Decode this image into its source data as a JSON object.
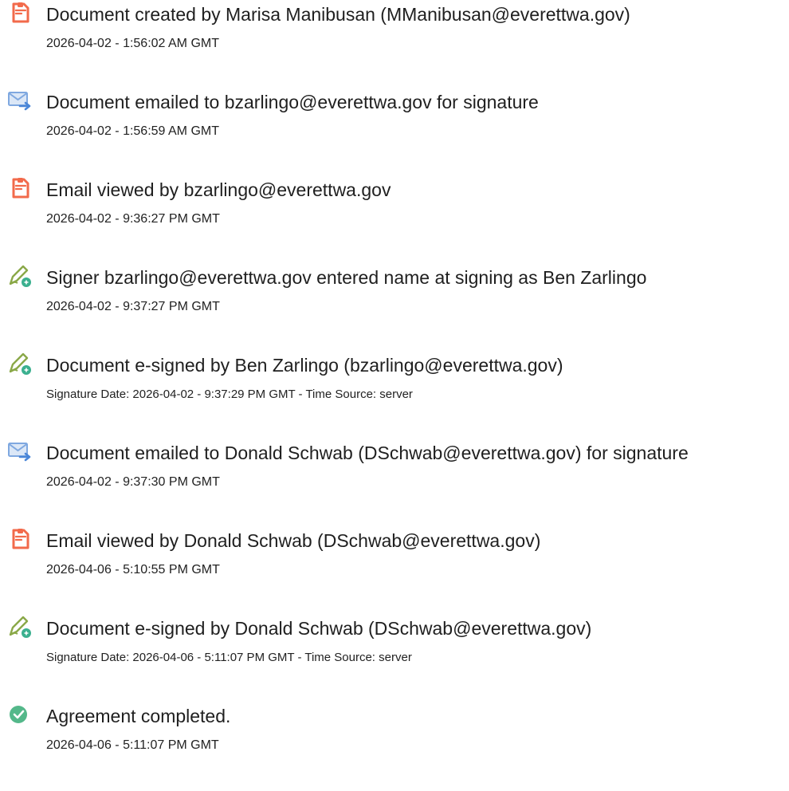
{
  "events": [
    {
      "icon": "document-icon",
      "title": "Document created by Marisa Manibusan (MManibusan@everettwa.gov)",
      "detail": "2026-04-02 - 1:56:02 AM GMT"
    },
    {
      "icon": "email-send-icon",
      "title": "Document emailed to bzarlingo@everettwa.gov for signature",
      "detail": "2026-04-02 - 1:56:59 AM GMT"
    },
    {
      "icon": "document-icon",
      "title": "Email viewed by bzarlingo@everettwa.gov",
      "detail": "2026-04-02 - 9:36:27 PM GMT"
    },
    {
      "icon": "pen-sign-icon",
      "title": "Signer bzarlingo@everettwa.gov entered name at signing as Ben Zarlingo",
      "detail": "2026-04-02 - 9:37:27 PM GMT"
    },
    {
      "icon": "pen-sign-icon",
      "title": "Document e-signed by Ben Zarlingo (bzarlingo@everettwa.gov)",
      "detail": "Signature Date: 2026-04-02 - 9:37:29 PM GMT - Time Source: server"
    },
    {
      "icon": "email-send-icon",
      "title": "Document emailed to Donald Schwab (DSchwab@everettwa.gov) for signature",
      "detail": "2026-04-02 - 9:37:30 PM GMT"
    },
    {
      "icon": "document-icon",
      "title": "Email viewed by Donald Schwab (DSchwab@everettwa.gov)",
      "detail": "2026-04-06 - 5:10:55 PM GMT"
    },
    {
      "icon": "pen-sign-icon",
      "title": "Document e-signed by Donald Schwab (DSchwab@everettwa.gov)",
      "detail": "Signature Date: 2026-04-06 - 5:11:07 PM GMT - Time Source: server"
    },
    {
      "icon": "check-circle-icon",
      "title": "Agreement completed.",
      "detail": "2026-04-06 - 5:11:07 PM GMT"
    }
  ],
  "colors": {
    "document": "#f26a4b",
    "email": "#7fa8e0",
    "pen": "#8aa848",
    "pen_badge": "#3bb08f",
    "check": "#54b88a"
  }
}
